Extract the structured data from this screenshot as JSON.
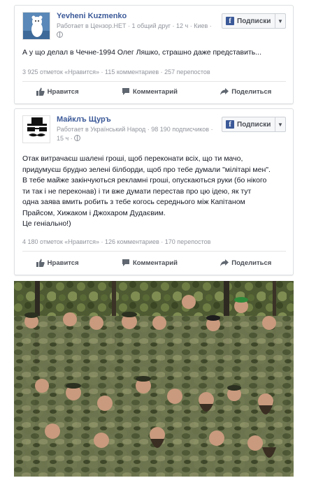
{
  "posts": [
    {
      "author": "Yevheni Kuzmenko",
      "meta": "Работает в Цензор.НЕТ · 1 общий друг · 12 ч · Киев ·",
      "subscribe_label": "Подписки",
      "text": "А у що делал в Чечне-1994 Олег Ляшко, страшно даже представить...",
      "stats": "3 925 отметок «Нравится» · 115 комментариев · 257 перепостов",
      "actions": {
        "like": "Нравится",
        "comment": "Комментарий",
        "share": "Поделиться"
      }
    },
    {
      "author": "Майклъ Щуръ",
      "meta": "Работает в Український Народ · 98 190 подписчиков ·",
      "meta2": "15 ч ·",
      "subscribe_label": "Подписки",
      "text_lines": [
        "Отак витрачаєш шалені гроші, щоб переконати всіх, що ти мачо,",
        "придумуєш брудно зелені білборди, щоб про тебе думали \"мілітарі мен\".",
        "В тебе майже закінчуються рекламні гроші, опускаються руки (бо нікого",
        "ти так і не переконав) і ти вже думати перестав про цю ідею, як тут",
        "одна заява вмить робить з тебе когось середнього між Капітаном",
        "Прайсом, Хижаком і Джохаром Дудаєвим.",
        "Це геніально!)"
      ],
      "stats": "4 180 отметок «Нравится» · 126 комментариев · 170 перепостов",
      "actions": {
        "like": "Нравится",
        "comment": "Комментарий",
        "share": "Поделиться"
      }
    }
  ],
  "colors": {
    "link": "#3b5998",
    "muted": "#90949c",
    "text": "#141823",
    "photo_bg": "#5d6140"
  }
}
